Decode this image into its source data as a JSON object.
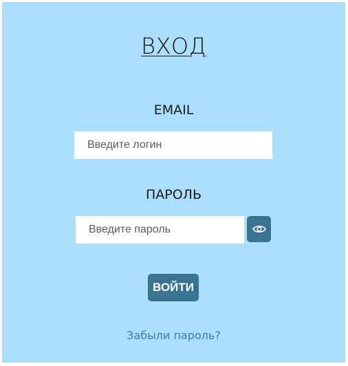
{
  "login": {
    "title": "ВХОД",
    "email_label": "EMAIL",
    "email_placeholder": "Введите логин",
    "email_value": "",
    "password_label": "ПАРОЛЬ",
    "password_placeholder": "Введите пароль",
    "password_value": "",
    "show_password_icon": "eye-icon",
    "submit_label": "ВОЙТИ",
    "forgot_link": "Забыли пароль?"
  },
  "colors": {
    "panel_background": "#abdffc",
    "button_background": "#3a7391",
    "link_color": "#3f7fa1"
  }
}
